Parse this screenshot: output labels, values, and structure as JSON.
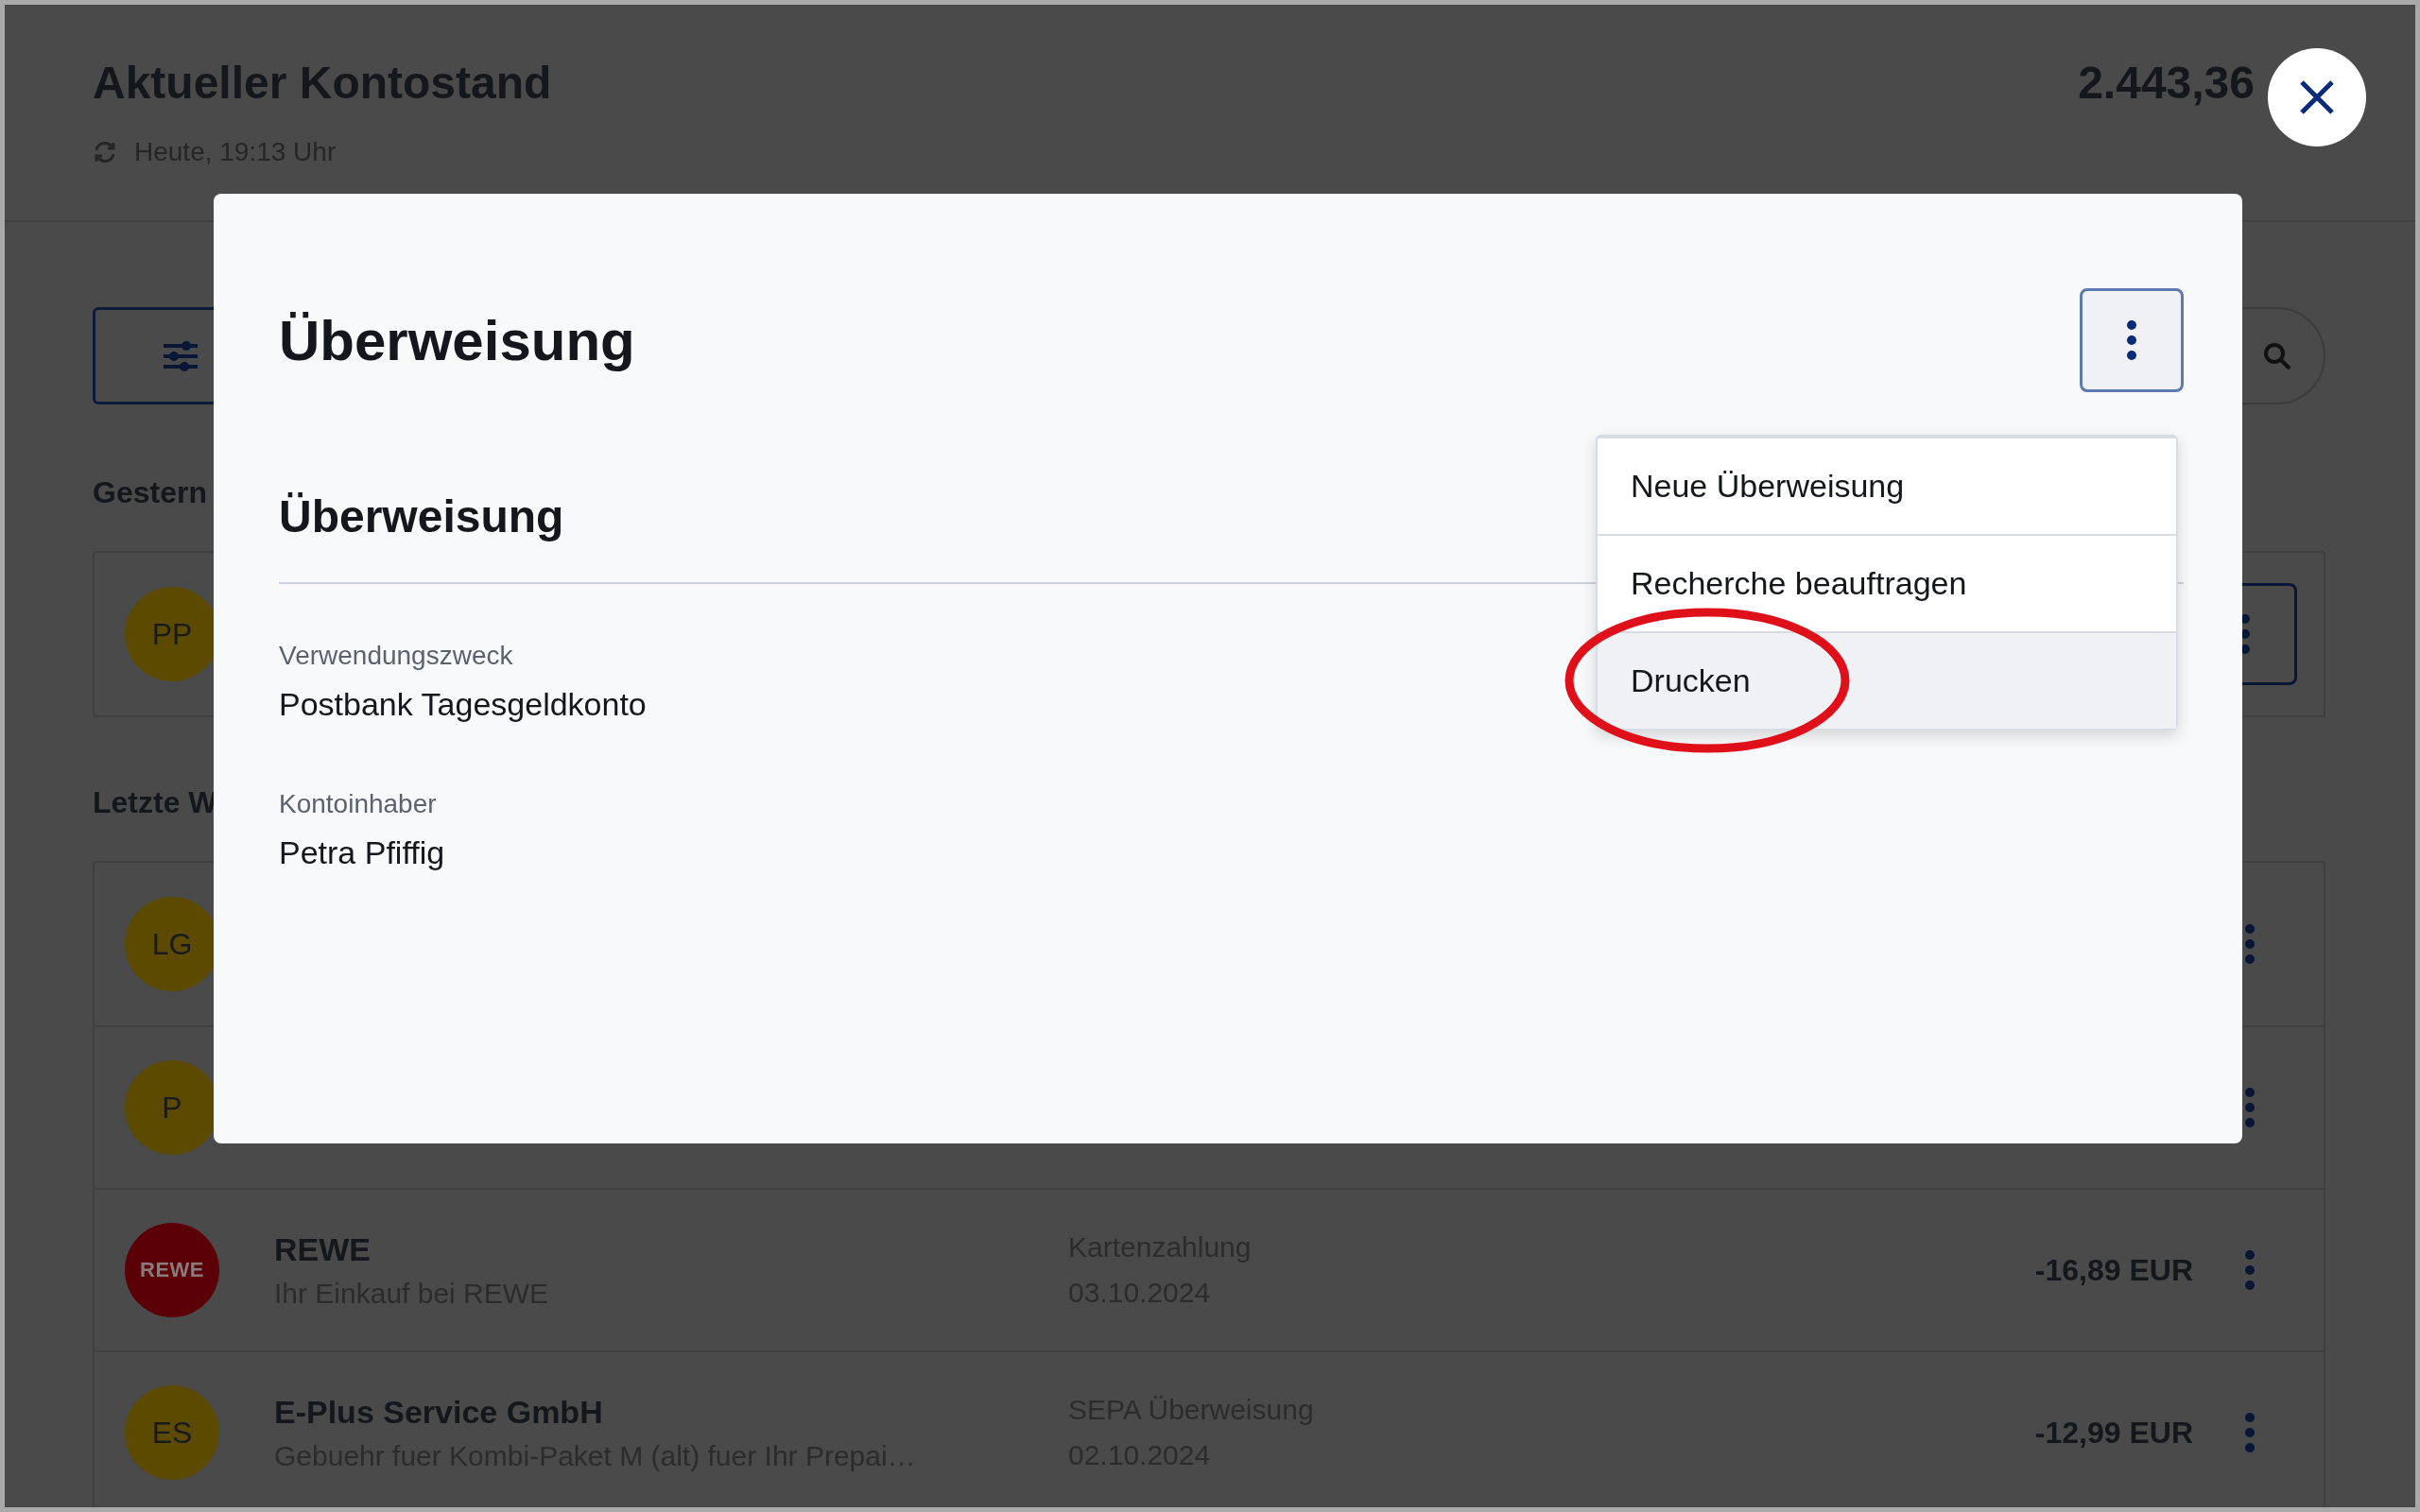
{
  "header": {
    "title": "Aktueller Kontostand",
    "updated": "Heute, 19:13 Uhr",
    "balance": "2.443,36"
  },
  "sections": [
    {
      "heading": "Gestern",
      "rows": [
        {
          "kind": "initials",
          "initials": "PP",
          "color": "#5c4a00",
          "selected": true
        }
      ]
    },
    {
      "heading": "Letzte W",
      "rows": [
        {
          "kind": "initials",
          "initials": "LG",
          "color": "#5c4a00",
          "selected": false
        },
        {
          "kind": "initials",
          "initials": "P",
          "color": "#5c4a00",
          "selected": false
        },
        {
          "kind": "logo",
          "initials": "REWE",
          "color": "#5c0008",
          "selected": false,
          "name": "REWE",
          "description": "Ihr Einkauf bei REWE",
          "type": "Kartenzahlung",
          "date": "03.10.2024",
          "amount": "-16,89 EUR"
        },
        {
          "kind": "initials",
          "initials": "ES",
          "color": "#5c4a00",
          "selected": false,
          "name": "E-Plus Service GmbH",
          "description": "Gebuehr fuer Kombi-Paket M (alt) fuer Ihr Prepai…",
          "type": "SEPA Überweisung",
          "date": "02.10.2024",
          "amount": "-12,99 EUR"
        }
      ]
    }
  ],
  "dialog": {
    "title": "Überweisung",
    "section_title": "Überweisung",
    "fields": [
      {
        "label": "Verwendungszweck",
        "value": "Postbank Tagesgeldkonto"
      },
      {
        "label": "Kontoinhaber",
        "value": "Petra Pfiffig"
      }
    ],
    "menu": [
      {
        "label": "Neue Überweisung",
        "selected": false,
        "circled": false
      },
      {
        "label": "Recherche beauftragen",
        "selected": false,
        "circled": false
      },
      {
        "label": "Drucken",
        "selected": true,
        "circled": true
      }
    ]
  }
}
